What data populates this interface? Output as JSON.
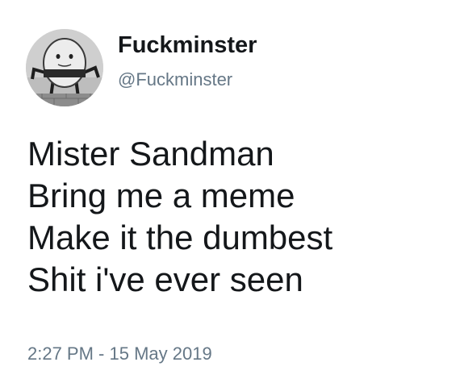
{
  "user": {
    "display_name": "Fuckminster",
    "handle": "@Fuckminster",
    "avatar_icon": "humpty-dumpty-avatar-icon"
  },
  "tweet": {
    "lines": [
      "Mister Sandman",
      "Bring me a meme",
      "Make it the dumbest",
      "Shit i've ever seen"
    ],
    "timestamp": "2:27 PM - 15 May 2019"
  },
  "colors": {
    "text_primary": "#14171a",
    "text_secondary": "#657786",
    "background": "#ffffff"
  }
}
